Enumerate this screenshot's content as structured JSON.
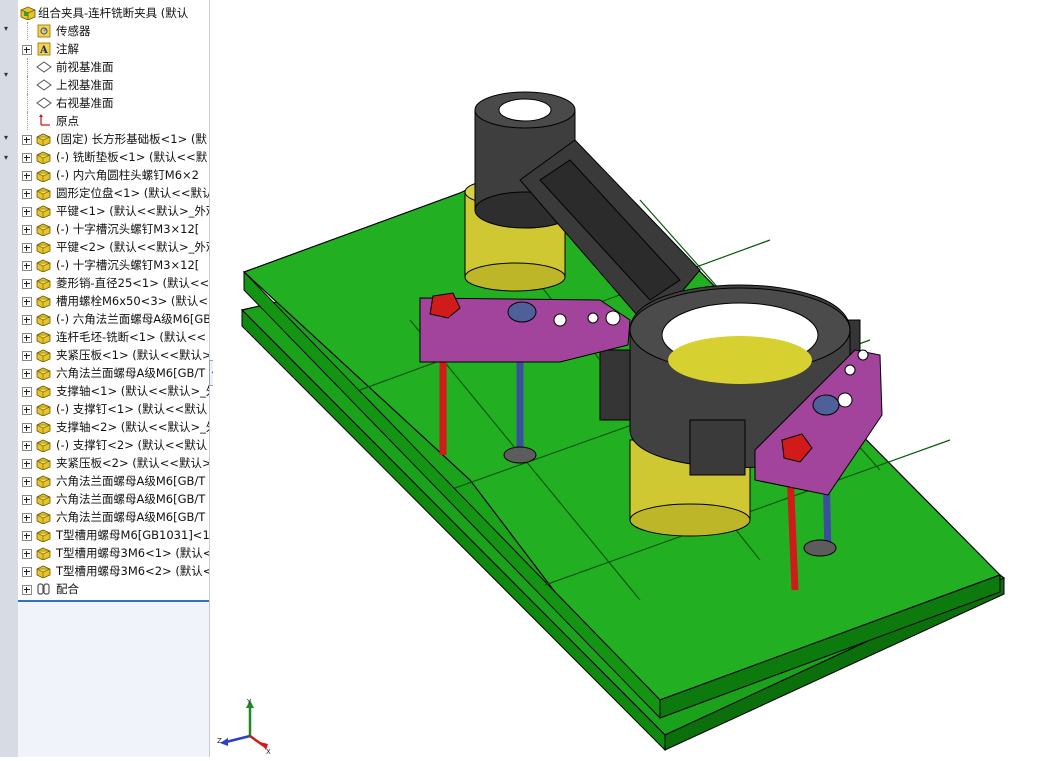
{
  "tree": {
    "root_label": "组合夹具-连杆铣断夹具  (默认",
    "items": [
      {
        "label": "传感器",
        "icon": "sensor-icon",
        "expand": false
      },
      {
        "label": "注解",
        "icon": "annotation-icon",
        "expand": true
      },
      {
        "label": "前视基准面",
        "icon": "plane-icon",
        "expand": false
      },
      {
        "label": "上视基准面",
        "icon": "plane-icon",
        "expand": false
      },
      {
        "label": "右视基准面",
        "icon": "plane-icon",
        "expand": false
      },
      {
        "label": "原点",
        "icon": "origin-icon",
        "expand": false
      },
      {
        "label": "(固定) 长方形基础板<1> (默",
        "icon": "part-icon",
        "expand": true
      },
      {
        "label": "(-) 铣断垫板<1> (默认<<默",
        "icon": "part-icon",
        "expand": true
      },
      {
        "label": "(-) 内六角圆柱头螺钉M6×2",
        "icon": "part-icon",
        "expand": true
      },
      {
        "label": "圆形定位盘<1> (默认<<默认",
        "icon": "part-icon",
        "expand": true
      },
      {
        "label": "平键<1> (默认<<默认>_外观",
        "icon": "part-icon",
        "expand": true
      },
      {
        "label": "(-) 十字槽沉头螺钉M3×12[",
        "icon": "part-icon",
        "expand": true
      },
      {
        "label": "平键<2> (默认<<默认>_外观",
        "icon": "part-icon",
        "expand": true
      },
      {
        "label": "(-) 十字槽沉头螺钉M3×12[",
        "icon": "part-icon",
        "expand": true
      },
      {
        "label": "菱形销-直径25<1> (默认<<",
        "icon": "part-icon",
        "expand": true
      },
      {
        "label": "槽用螺栓M6x50<3> (默认<<",
        "icon": "part-icon",
        "expand": true
      },
      {
        "label": "(-) 六角法兰面螺母A级M6[GB",
        "icon": "part-icon",
        "expand": true
      },
      {
        "label": "连杆毛坯-铣断<1> (默认<<",
        "icon": "part-icon",
        "expand": true
      },
      {
        "label": "夹紧压板<1> (默认<<默认>_",
        "icon": "part-icon",
        "expand": true
      },
      {
        "label": "六角法兰面螺母A级M6[GB/T",
        "icon": "part-icon",
        "expand": true
      },
      {
        "label": "支撑轴<1> (默认<<默认>_外",
        "icon": "part-icon",
        "expand": true
      },
      {
        "label": "(-) 支撑钉<1> (默认<<默认",
        "icon": "part-icon",
        "expand": true
      },
      {
        "label": "支撑轴<2> (默认<<默认>_外",
        "icon": "part-icon",
        "expand": true
      },
      {
        "label": "(-) 支撑钉<2> (默认<<默认",
        "icon": "part-icon",
        "expand": true
      },
      {
        "label": "夹紧压板<2> (默认<<默认>_",
        "icon": "part-icon",
        "expand": true
      },
      {
        "label": "六角法兰面螺母A级M6[GB/T",
        "icon": "part-icon",
        "expand": true
      },
      {
        "label": "六角法兰面螺母A级M6[GB/T",
        "icon": "part-icon",
        "expand": true
      },
      {
        "label": "六角法兰面螺母A级M6[GB/T",
        "icon": "part-icon",
        "expand": true
      },
      {
        "label": "T型槽用螺母M6[GB1031]<14>",
        "icon": "part-icon",
        "expand": true
      },
      {
        "label": "T型槽用螺母3M6<1> (默认<<",
        "icon": "part-icon",
        "expand": true
      },
      {
        "label": "T型槽用螺母3M6<2> (默认<<",
        "icon": "part-icon",
        "expand": true
      },
      {
        "label": "配合",
        "icon": "mates-icon",
        "expand": true
      }
    ]
  },
  "triad": {
    "x_label": "X",
    "y_label": "Y",
    "z_label": "Z"
  },
  "colors": {
    "plate_green": "#1aa31a",
    "plate_green_dark": "#0b6f0b",
    "locator_yellow": "#cfc832",
    "rod_gray": "#3e3e3e",
    "clamp_purple": "#a2449b",
    "nut_red": "#d11a1a",
    "stud_blue": "#3a4fa0",
    "selection_blue": "#2f6fc4"
  }
}
